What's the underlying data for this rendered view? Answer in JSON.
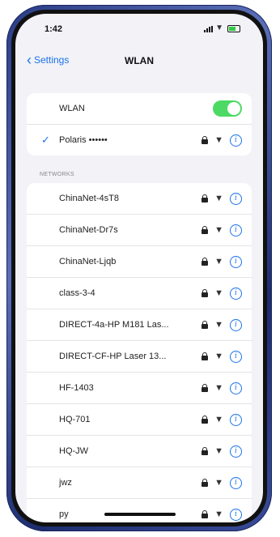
{
  "status_bar": {
    "time": "1:42"
  },
  "nav": {
    "back_label": "Settings",
    "title": "WLAN"
  },
  "wlan_group": {
    "toggle_label": "WLAN",
    "toggle_on": true,
    "connected_network": "Polaris ••••••"
  },
  "networks_header": "NETWORKS",
  "networks": [
    {
      "name": "ChinaNet-4sT8"
    },
    {
      "name": "ChinaNet-Dr7s"
    },
    {
      "name": "ChinaNet-Ljqb"
    },
    {
      "name": "class-3-4"
    },
    {
      "name": "DIRECT-4a-HP M181 Las..."
    },
    {
      "name": "DIRECT-CF-HP Laser 13..."
    },
    {
      "name": "HF-1403"
    },
    {
      "name": "HQ-701"
    },
    {
      "name": "HQ-JW"
    },
    {
      "name": "jwz"
    },
    {
      "name": "py"
    }
  ],
  "colors": {
    "accent": "#1a73e8",
    "toggle_on": "#4cd964",
    "frame": "#2a3c86"
  }
}
